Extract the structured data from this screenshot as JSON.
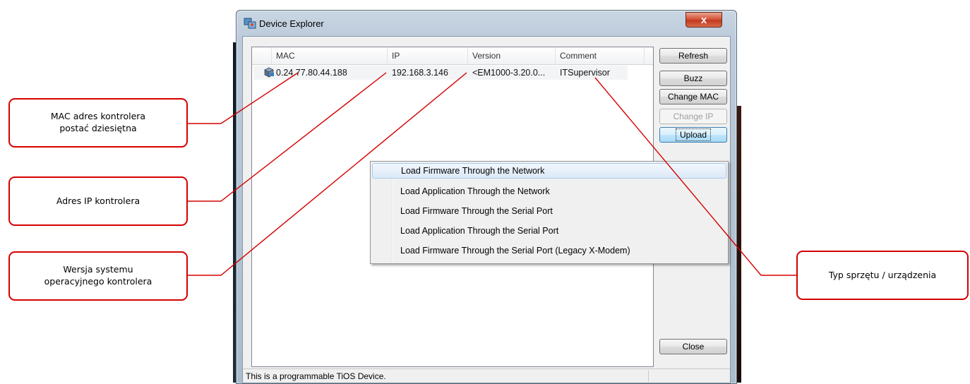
{
  "window": {
    "title": "Device Explorer",
    "close_glyph": "x",
    "app_icon": "device-explorer-icon"
  },
  "list": {
    "columns": [
      "MAC",
      "IP",
      "Version",
      "Comment"
    ],
    "rows": [
      {
        "mac": "0.24.77.80.44.188",
        "ip": "192.168.3.146",
        "version": "<EM1000-3.20.0...",
        "comment": "ITSupervisor"
      }
    ]
  },
  "buttons": {
    "refresh": "Refresh",
    "buzz": "Buzz",
    "change_mac": "Change MAC",
    "change_ip": "Change IP",
    "upload": "Upload",
    "close": "Close"
  },
  "upload_menu": {
    "items": [
      "Load Firmware Through the Network",
      "Load Application Through the Network",
      "Load Firmware Through the Serial Port",
      "Load Application Through the Serial Port",
      "Load Firmware Through the Serial Port (Legacy X-Modem)"
    ],
    "highlighted_index": 0
  },
  "status_bar": {
    "text": "This is a programmable TiOS Device."
  },
  "annotations": {
    "mac": "MAC adres kontrolera\npostać dziesiętna",
    "ip": "Adres IP kontrolera",
    "version": "Wersja systemu\noperacyjnego kontrolera",
    "type": "Typ sprzętu / urządzenia"
  },
  "colors": {
    "callout_border": "#d40000",
    "menu_highlight": "#dce9f8",
    "button_focus": "#3c7fb1"
  }
}
